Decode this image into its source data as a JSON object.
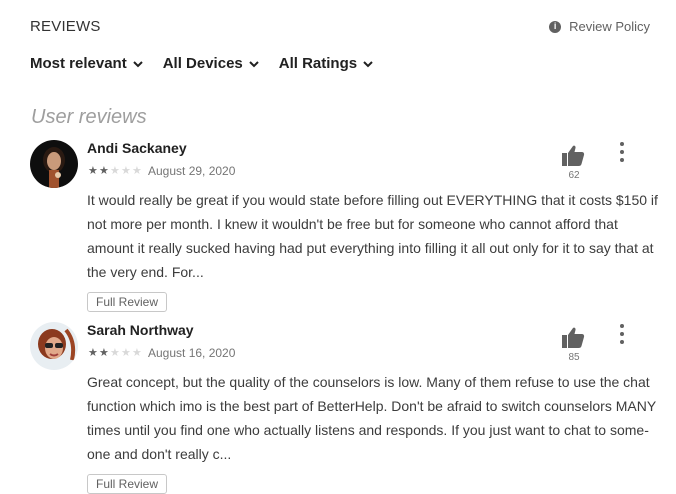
{
  "header": {
    "title": "REVIEWS",
    "policy_label": "Review Policy"
  },
  "filters": [
    {
      "label": "Most relevant"
    },
    {
      "label": "All Devices"
    },
    {
      "label": "All Ratings"
    }
  ],
  "section_title": "User reviews",
  "reviews": [
    {
      "author": "Andi Sackaney",
      "rating": 2,
      "date": "August 29, 2020",
      "text": "It would really be great if you would state before filling out EVERYTHING that it costs $150 if not more per month. I knew it wouldn't be free but for someone who cannot afford that amount it really sucked having had put everything into filling it all out only for it to say that at the very end. For...",
      "helpful_count": "62",
      "full_review_label": "Full Review"
    },
    {
      "author": "Sarah Northway",
      "rating": 2,
      "date": "August 16, 2020",
      "text": "Great concept, but the quality of the counselors is low. Many of them refuse to use the chat function which imo is the best part of BetterHelp. Don't be afraid to switch counselors MANY times until you find one who actually listens and responds. If you just want to chat to some-one and don't really c...",
      "helpful_count": "85",
      "full_review_label": "Full Review"
    }
  ]
}
